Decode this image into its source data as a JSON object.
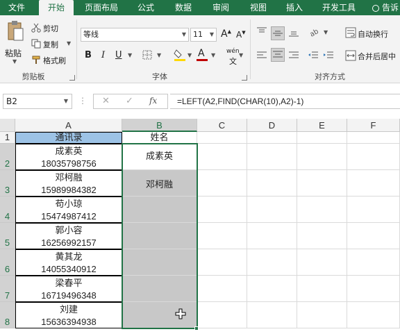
{
  "tabs": [
    "文件",
    "开始",
    "页面布局",
    "公式",
    "数据",
    "审阅",
    "视图",
    "插入",
    "开发工具",
    "告诉"
  ],
  "active_tab": "开始",
  "clipboard": {
    "paste": "粘贴",
    "cut": "剪切",
    "copy": "复制",
    "format_painter": "格式刷",
    "label": "剪贴板"
  },
  "font": {
    "name": "等线",
    "size": "11",
    "label": "字体",
    "bold": "B",
    "italic": "I",
    "underline": "U",
    "grow": "A",
    "shrink": "A",
    "font_color": "A",
    "phonetic": "wén"
  },
  "alignment": {
    "wrap": "自动换行",
    "merge": "合并后居中",
    "label": "对齐方式"
  },
  "namebox": "B2",
  "formula": "=LEFT(A2,FIND(CHAR(10),A2)-1)",
  "fx": "fx",
  "columns": [
    "A",
    "B",
    "C",
    "D",
    "E",
    "F"
  ],
  "rows": [
    "1",
    "2",
    "3",
    "4",
    "5",
    "6",
    "7",
    "8"
  ],
  "a1": "通讯录",
  "b1": "姓名",
  "contacts": [
    {
      "name": "成素英",
      "phone": "18035798756"
    },
    {
      "name": "邓柯融",
      "phone": "15989984382"
    },
    {
      "name": "苟小琼",
      "phone": "15474987412"
    },
    {
      "name": "郭小容",
      "phone": "16256992157"
    },
    {
      "name": "黄其龙",
      "phone": "14055340912"
    },
    {
      "name": "梁春平",
      "phone": "16719496348"
    },
    {
      "name": "刘建",
      "phone": "15636394938"
    }
  ],
  "b_values": [
    "成素英",
    "邓柯融",
    "",
    "",
    "",
    "",
    ""
  ],
  "colors": {
    "brand": "#217346",
    "header_fill": "#9dc3e6",
    "selection_gray": "#c8c8c8"
  }
}
